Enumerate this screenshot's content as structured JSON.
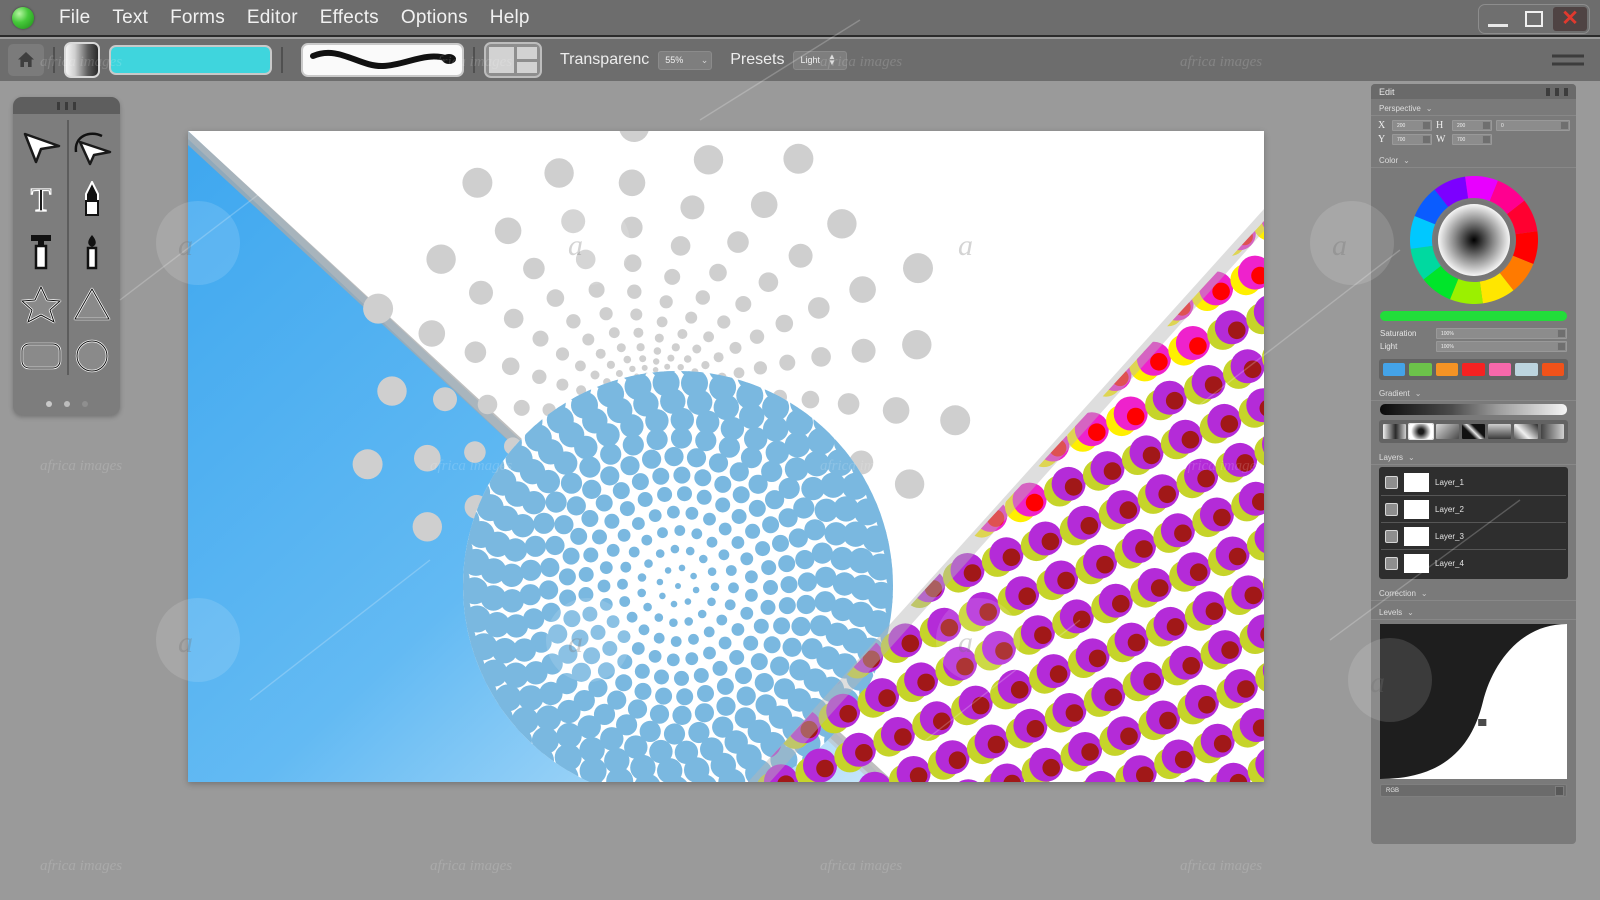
{
  "app": {
    "logo_icon": "green-orb-logo",
    "menu": [
      "File",
      "Text",
      "Forms",
      "Editor",
      "Effects",
      "Options",
      "Help"
    ],
    "window_controls": {
      "minimize": "minimize-icon",
      "maximize": "maximize-icon",
      "close": "✕"
    }
  },
  "toolbar": {
    "home_icon": "home-icon",
    "gradient_swatch": "gradient-swatch",
    "color_swatch_value": "#3fd5dd",
    "brush_preview": "brush-stroke-preview",
    "layout_icon": "layout-icon",
    "transparency_label": "Transparenc",
    "transparency_value": "55%",
    "presets_label": "Presets",
    "presets_value": "Light",
    "menu_icon": "hamburger-menu-icon"
  },
  "tools": {
    "handle": "drag-handle",
    "items": [
      {
        "name": "select-arrow-tool",
        "icon": "cursor-arrow"
      },
      {
        "name": "curve-select-tool",
        "icon": "curve-arrow"
      },
      {
        "name": "text-tool",
        "icon": "letter-T"
      },
      {
        "name": "pen-tool",
        "icon": "pen"
      },
      {
        "name": "eyedropper-tool",
        "icon": "eyedropper"
      },
      {
        "name": "brush-tool",
        "icon": "brush"
      },
      {
        "name": "star-shape-tool",
        "icon": "star"
      },
      {
        "name": "triangle-shape-tool",
        "icon": "triangle"
      },
      {
        "name": "rounded-rect-tool",
        "icon": "rounded-rectangle"
      },
      {
        "name": "ellipse-tool",
        "icon": "circle"
      }
    ],
    "page_dots": 3
  },
  "panel": {
    "title": "Edit",
    "perspective": {
      "label": "Perspective",
      "x_label": "X",
      "x_value": "200",
      "y_label": "Y",
      "y_value": "700",
      "h_label": "H",
      "h_value": "200",
      "w_label": "W",
      "w_value": "700",
      "extra_value": "0"
    },
    "color": {
      "label": "Color",
      "wheel_icon": "color-wheel",
      "current_color": "#22dd3a",
      "saturation_label": "Saturation",
      "saturation_value": "100%",
      "light_label": "Light",
      "light_value": "100%",
      "swatches": [
        "#44a3e8",
        "#6cc24a",
        "#f59324",
        "#f62222",
        "#f768ab",
        "#bcd4de",
        "#f0521a"
      ]
    },
    "gradient": {
      "label": "Gradient",
      "bar_from": "#0b0b0b",
      "bar_to": "#f5f5f5",
      "presets_count": 7,
      "selected_index": 1
    },
    "layers": {
      "label": "Layers",
      "items": [
        {
          "name": "Layer_1",
          "visible": true
        },
        {
          "name": "Layer_2",
          "visible": true
        },
        {
          "name": "Layer_3",
          "visible": true
        },
        {
          "name": "Layer_4",
          "visible": true
        }
      ]
    },
    "correction": {
      "label": "Correction"
    },
    "levels": {
      "label": "Levels",
      "channel_value": "RGB",
      "curve": "s-curve"
    }
  },
  "canvas": {
    "name": "artwork-canvas",
    "blue_light": "#8fd0f5",
    "blue_dark": "#3ea7ef",
    "halftone_gray": "#cccccc",
    "halftone_blue": "#7ab8e0",
    "magenta": "#ee22cc",
    "yellow": "#ffef00",
    "red": "#ff0000",
    "white": "#ffffff"
  }
}
